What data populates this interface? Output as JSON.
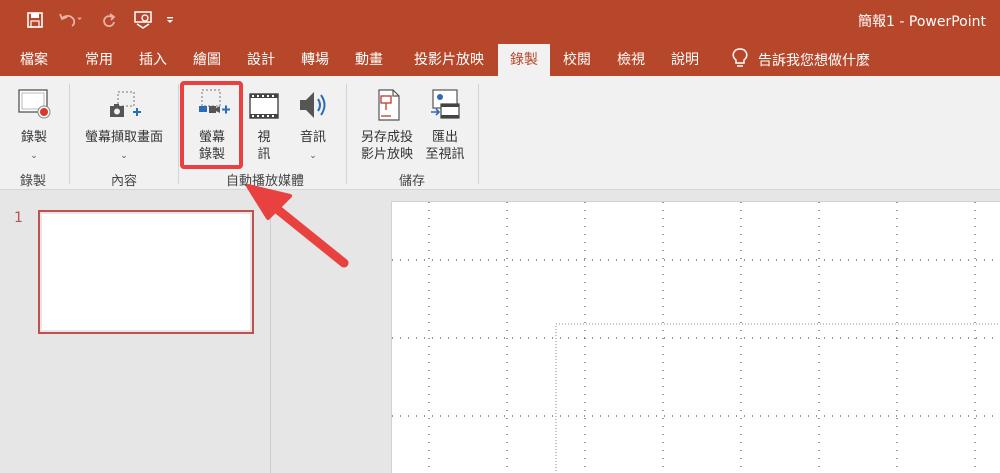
{
  "window": {
    "title": "簡報1  -  PowerPoint"
  },
  "quick_access": {
    "icons": [
      "save-icon",
      "undo-icon",
      "redo-icon",
      "present-icon",
      "customize-icon"
    ]
  },
  "tabs": [
    {
      "label": "檔案",
      "active": false
    },
    {
      "label": "常用",
      "active": false
    },
    {
      "label": "插入",
      "active": false
    },
    {
      "label": "繪圖",
      "active": false
    },
    {
      "label": "設計",
      "active": false
    },
    {
      "label": "轉場",
      "active": false
    },
    {
      "label": "動畫",
      "active": false
    },
    {
      "label": "投影片放映",
      "active": false
    },
    {
      "label": "錄製",
      "active": true
    },
    {
      "label": "校閱",
      "active": false
    },
    {
      "label": "檢視",
      "active": false
    },
    {
      "label": "說明",
      "active": false
    }
  ],
  "tell_me": {
    "text": "告訴我您想做什麼",
    "icon": "lightbulb-icon"
  },
  "ribbon": {
    "groups": {
      "record": {
        "label": "錄製",
        "buttons": {
          "record": {
            "label": "錄製"
          }
        }
      },
      "content": {
        "label": "內容",
        "buttons": {
          "screenshot": {
            "label": "螢幕擷取畫面"
          }
        }
      },
      "automedia": {
        "label": "自動播放媒體",
        "buttons": {
          "screen_recording": {
            "line1": "螢幕",
            "line2": "錄製"
          },
          "video": {
            "line1": "視",
            "line2": "訊"
          },
          "audio": {
            "label": "音訊"
          }
        }
      },
      "save": {
        "label": "儲存",
        "buttons": {
          "save_as_show": {
            "line1": "另存成投",
            "line2": "影片放映"
          },
          "export_video": {
            "line1": "匯出",
            "line2": "至視訊"
          }
        }
      }
    }
  },
  "slides_pane": {
    "slide_number": "1"
  },
  "colors": {
    "accent": "#b7472a",
    "highlight": "#e8413f"
  }
}
